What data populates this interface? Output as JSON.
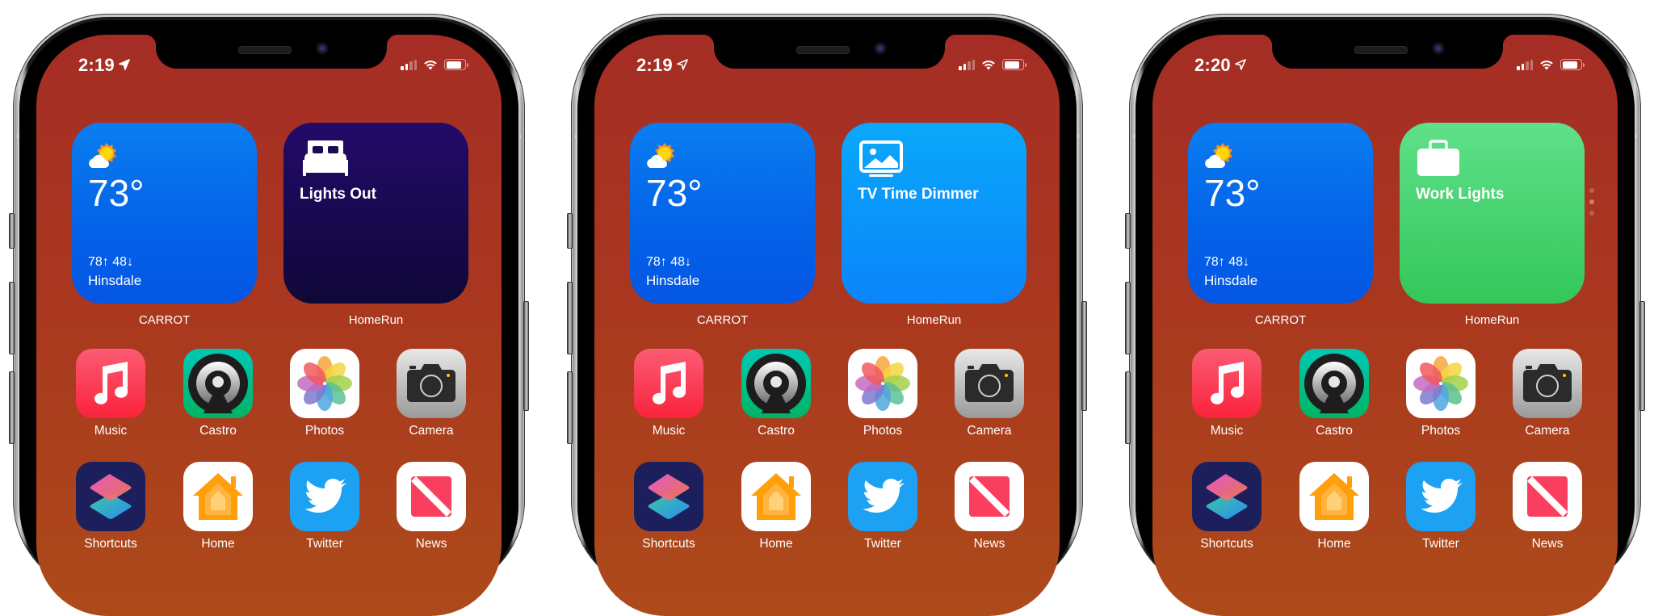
{
  "phones": [
    {
      "status": {
        "time": "2:19",
        "location_icon": "location-arrow-filled",
        "signal_bars": 2,
        "signal_total": 4,
        "wifi": true,
        "battery_level": 0.85
      },
      "widgets": {
        "weather": {
          "app_label": "CARROT",
          "condition_icon": "partly-cloudy-icon",
          "temperature": "73°",
          "hi_lo": "78↑ 48↓",
          "city": "Hinsdale"
        },
        "homerun": {
          "app_label": "HomeRun",
          "scene_icon": "bed-icon",
          "scene_title": "Lights Out",
          "color_top": "#220a6a",
          "color_bottom": "#100838"
        }
      },
      "page_indicator": false
    },
    {
      "status": {
        "time": "2:19",
        "location_icon": "location-arrow-outline",
        "signal_bars": 2,
        "signal_total": 4,
        "wifi": true,
        "battery_level": 0.85
      },
      "widgets": {
        "weather": {
          "app_label": "CARROT",
          "condition_icon": "partly-cloudy-icon",
          "temperature": "73°",
          "hi_lo": "78↑ 48↓",
          "city": "Hinsdale"
        },
        "homerun": {
          "app_label": "HomeRun",
          "scene_icon": "tv-icon",
          "scene_title": "TV Time Dimmer",
          "color_top": "#0aa8fa",
          "color_bottom": "#0a84fa"
        }
      },
      "page_indicator": false
    },
    {
      "status": {
        "time": "2:20",
        "location_icon": "location-arrow-outline",
        "signal_bars": 2,
        "signal_total": 4,
        "wifi": true,
        "battery_level": 0.85
      },
      "widgets": {
        "weather": {
          "app_label": "CARROT",
          "condition_icon": "partly-cloudy-icon",
          "temperature": "73°",
          "hi_lo": "78↑ 48↓",
          "city": "Hinsdale"
        },
        "homerun": {
          "app_label": "HomeRun",
          "scene_icon": "briefcase-icon",
          "scene_title": "Work Lights",
          "color_top": "#5fe08a",
          "color_bottom": "#34c759"
        }
      },
      "page_indicator": true,
      "page_indicator_pages": 3,
      "page_indicator_active": 2
    }
  ],
  "apps": [
    {
      "label": "Music",
      "icon": "music-icon"
    },
    {
      "label": "Castro",
      "icon": "castro-icon"
    },
    {
      "label": "Photos",
      "icon": "photos-icon"
    },
    {
      "label": "Camera",
      "icon": "camera-icon"
    },
    {
      "label": "Shortcuts",
      "icon": "shortcuts-icon"
    },
    {
      "label": "Home",
      "icon": "home-icon"
    },
    {
      "label": "Twitter",
      "icon": "twitter-icon"
    },
    {
      "label": "News",
      "icon": "news-icon"
    }
  ],
  "colors": {
    "wallpaper_top": "#a52d25",
    "wallpaper_bottom": "#ad4a1a",
    "weather_widget": "#0463e8"
  }
}
